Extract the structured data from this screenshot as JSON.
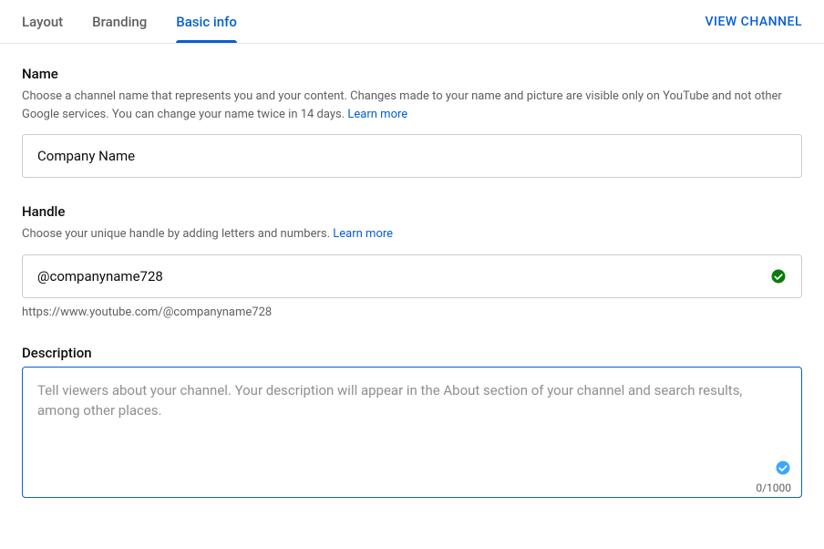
{
  "header": {
    "tabs": [
      {
        "label": "Layout",
        "active": false
      },
      {
        "label": "Branding",
        "active": false
      },
      {
        "label": "Basic info",
        "active": true
      }
    ],
    "view_channel": "VIEW CHANNEL"
  },
  "name_section": {
    "title": "Name",
    "desc": "Choose a channel name that represents you and your content. Changes made to your name and picture are visible only on YouTube and not other Google services. You can change your name twice in 14 days. ",
    "learn_more": "Learn more",
    "value": "Company Name"
  },
  "handle_section": {
    "title": "Handle",
    "desc": "Choose your unique handle by adding letters and numbers. ",
    "learn_more": "Learn more",
    "value": "@companyname728",
    "url": "https://www.youtube.com/@companyname728"
  },
  "description_section": {
    "title": "Description",
    "placeholder": "Tell viewers about your channel. Your description will appear in the About section of your channel and search results, among other places.",
    "value": "",
    "char_count": "0/1000"
  }
}
